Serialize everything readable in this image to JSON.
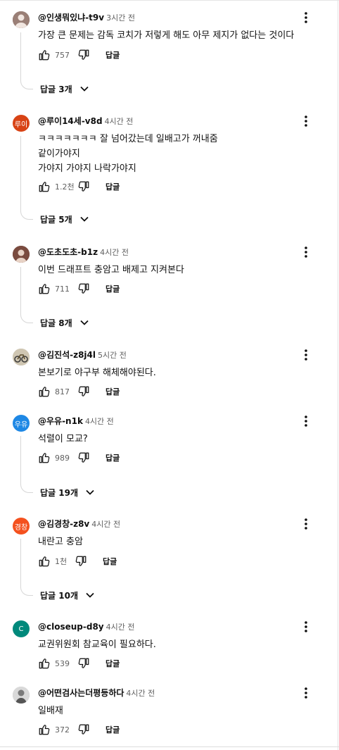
{
  "reply_label": "답글",
  "comments": [
    {
      "avatar_text": "",
      "avatar_color": "#8a6f66",
      "author": "@인생뭐있냐-t9v",
      "time": "3시간 전",
      "lines": [
        "가장 큰 문제는 감독 코치가 저렇게 해도 아무 제지가 없다는 것이다"
      ],
      "likes": "757",
      "replies": "답글 3개"
    },
    {
      "avatar_text": "루이",
      "avatar_color": "#e8462d",
      "author": "@루이14세-v8d",
      "time": "4시간 전",
      "lines": [
        "ㅋㅋㅋㅋㅋㅋㅋ 잘 넘어갔는데 일배고가 꺼내줌",
        "같이가야지",
        "가야지 가야지 나락가야지"
      ],
      "likes": "1.2천",
      "replies": "답글 5개"
    },
    {
      "avatar_text": "",
      "avatar_color": "#7a4b3f",
      "author": "@도초도초-b1z",
      "time": "4시간 전",
      "lines": [
        "이번 드래프트 충암고 배제고 지켜본다"
      ],
      "likes": "711",
      "replies": "답글 8개"
    },
    {
      "avatar_text": "",
      "avatar_color": "#9b8c6e",
      "author": "@김진석-z8j4l",
      "time": "5시간 전",
      "lines": [
        "본보기로 야구부 해체해야된다."
      ],
      "likes": "817",
      "replies": ""
    },
    {
      "avatar_text": "우유",
      "avatar_color": "#1e88e5",
      "author": "@우유-n1k",
      "time": "4시간 전",
      "lines": [
        "석렬이 모교?"
      ],
      "likes": "989",
      "replies": "답글 19개"
    },
    {
      "avatar_text": "경창",
      "avatar_color": "#f4511e",
      "author": "@김경창-z8v",
      "time": "4시간 전",
      "lines": [
        "내란고 충암"
      ],
      "likes": "1천",
      "replies": "답글 10개"
    },
    {
      "avatar_text": "C",
      "avatar_color": "#00897b",
      "author": "@closeup-d8y",
      "time": "4시간 전",
      "lines": [
        "교권위원회 참교육이 필요하다."
      ],
      "likes": "539",
      "replies": ""
    },
    {
      "avatar_text": "",
      "avatar_color": "#bdbdbd",
      "author": "@어떤검사는더평등하다",
      "time": "4시간 전",
      "lines": [
        "일배재"
      ],
      "likes": "372",
      "replies": ""
    }
  ]
}
